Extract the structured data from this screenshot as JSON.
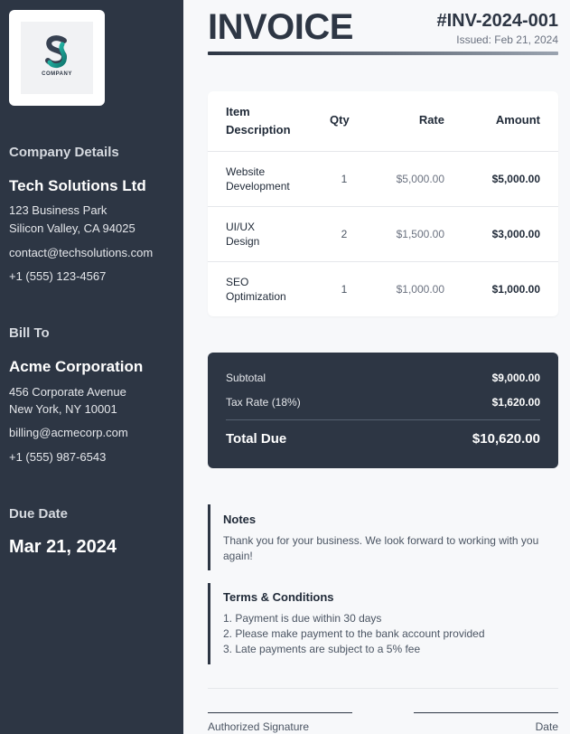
{
  "company": {
    "logo_name": "COMPANY",
    "section_title": "Company Details",
    "name": "Tech Solutions Ltd",
    "address_line1": "123 Business Park",
    "address_line2": "Silicon Valley, CA 94025",
    "email": "contact@techsolutions.com",
    "phone": "+1 (555) 123-4567"
  },
  "bill_to": {
    "section_title": "Bill To",
    "name": "Acme Corporation",
    "address_line1": "456 Corporate Avenue",
    "address_line2": "New York, NY 10001",
    "email": "billing@acmecorp.com",
    "phone": "+1 (555) 987-6543"
  },
  "due": {
    "section_title": "Due Date",
    "date": "Mar 21, 2024"
  },
  "header": {
    "title": "INVOICE",
    "invoice_number": "#INV-2024-001",
    "issued": "Issued: Feb 21, 2024"
  },
  "table": {
    "headers": {
      "description_line1": "Item",
      "description_line2": "Description",
      "qty": "Qty",
      "rate": "Rate",
      "amount": "Amount"
    },
    "rows": [
      {
        "desc1": "Website",
        "desc2": "Development",
        "qty": "1",
        "rate": "$5,000.00",
        "amount": "$5,000.00"
      },
      {
        "desc1": "UI/UX",
        "desc2": "Design",
        "qty": "2",
        "rate": "$1,500.00",
        "amount": "$3,000.00"
      },
      {
        "desc1": "SEO",
        "desc2": "Optimization",
        "qty": "1",
        "rate": "$1,000.00",
        "amount": "$1,000.00"
      }
    ]
  },
  "totals": {
    "subtotal_label": "Subtotal",
    "subtotal": "$9,000.00",
    "tax_label": "Tax Rate (18%)",
    "tax": "$1,620.00",
    "total_label": "Total Due",
    "total": "$10,620.00"
  },
  "notes": {
    "title": "Notes",
    "text": "Thank you for your business. We look forward to working with you again!"
  },
  "terms": {
    "title": "Terms & Conditions",
    "items": [
      "1. Payment is due within 30 days",
      "2. Please make payment to the bank account provided",
      "3. Late payments are subject to a 5% fee"
    ]
  },
  "signature": {
    "left_label": "Authorized Signature",
    "right_label": "Date"
  }
}
